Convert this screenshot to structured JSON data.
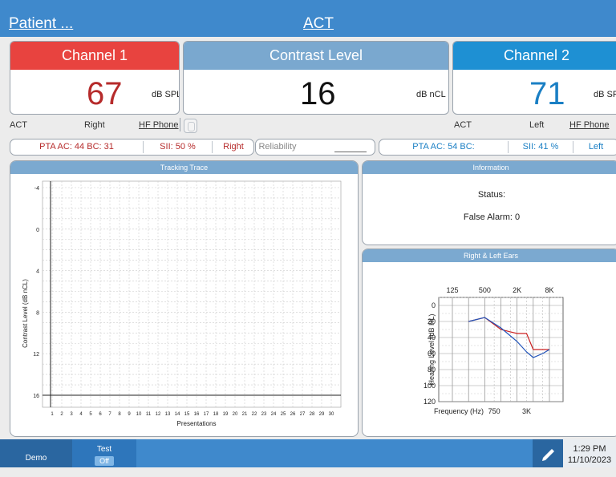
{
  "header": {
    "patient_link": "Patient ...",
    "test_name": "ACT"
  },
  "channel1": {
    "title": "Channel 1",
    "color": "#e8433f",
    "value": "67",
    "value_color": "#b62b2b",
    "unit": "dB SPL",
    "mode": "ACT",
    "ear": "Right",
    "transducer": "HF Phone"
  },
  "contrast": {
    "title": "Contrast Level",
    "color": "#7aa8cf",
    "value": "16",
    "unit": "dB nCL"
  },
  "channel2": {
    "title": "Channel 2",
    "color": "#1e90d3",
    "value": "71",
    "value_color": "#1a7fc4",
    "unit": "dB SPL",
    "mode": "ACT",
    "ear": "Left",
    "transducer": "HF Phone"
  },
  "summary_right": {
    "pta": "PTA AC: 44 BC: 31",
    "sii": "SII: 50 %",
    "ear": "Right"
  },
  "reliability": {
    "label": "Reliability"
  },
  "summary_left": {
    "pta": "PTA AC: 54 BC:",
    "sii": "SII: 41 %",
    "ear": "Left"
  },
  "tracking": {
    "title": "Tracking Trace",
    "ylabel": "Contrast Level (dB nCL)",
    "xlabel": "Presentations",
    "y_ticks": [
      "-4",
      "0",
      "4",
      "8",
      "12",
      "16"
    ],
    "x_ticks": [
      "1",
      "2",
      "3",
      "4",
      "5",
      "6",
      "7",
      "8",
      "9",
      "10",
      "11",
      "12",
      "13",
      "14",
      "15",
      "16",
      "17",
      "18",
      "19",
      "20",
      "21",
      "22",
      "23",
      "24",
      "25",
      "26",
      "27",
      "28",
      "29",
      "30"
    ]
  },
  "information": {
    "title": "Information",
    "status_label": "Status:",
    "false_alarm": "False Alarm: 0"
  },
  "ears": {
    "title": "Right & Left Ears",
    "ylabel": "Hearing Level (dB HL)",
    "xlabel": "Frequency (Hz)",
    "top_ticks": [
      "125",
      "500",
      "2K",
      "8K"
    ],
    "bottom_ticks": [
      "750",
      "3K"
    ],
    "y_ticks": [
      "0",
      "20",
      "40",
      "60",
      "80",
      "100",
      "120"
    ]
  },
  "chart_data": [
    {
      "type": "line",
      "title": "Tracking Trace",
      "xlabel": "Presentations",
      "ylabel": "Contrast Level (dB nCL)",
      "xlim": [
        1,
        30
      ],
      "ylim": [
        -4,
        16
      ],
      "y_inverted": true,
      "grid": true,
      "series": []
    },
    {
      "type": "line",
      "title": "Right & Left Ears",
      "xlabel": "Frequency (Hz)",
      "ylabel": "Hearing Level (dB HL)",
      "x_scale": "log",
      "ylim": [
        -10,
        120
      ],
      "y_inverted": true,
      "grid": true,
      "x": [
        250,
        500,
        1000,
        2000,
        3000,
        4000,
        6000,
        8000
      ],
      "series": [
        {
          "name": "",
          "color": "#cc2222",
          "values": [
            20,
            15,
            30,
            35,
            35,
            55,
            55,
            55
          ]
        },
        {
          "name": "",
          "color": "#2255bb",
          "values": [
            20,
            15,
            28,
            45,
            58,
            65,
            60,
            55
          ]
        }
      ]
    }
  ],
  "bottom": {
    "demo": "Demo",
    "test_label": "Test",
    "test_state": "Off",
    "pen_icon": "pen-icon",
    "time": "1:29 PM",
    "date": "11/10/2023"
  }
}
